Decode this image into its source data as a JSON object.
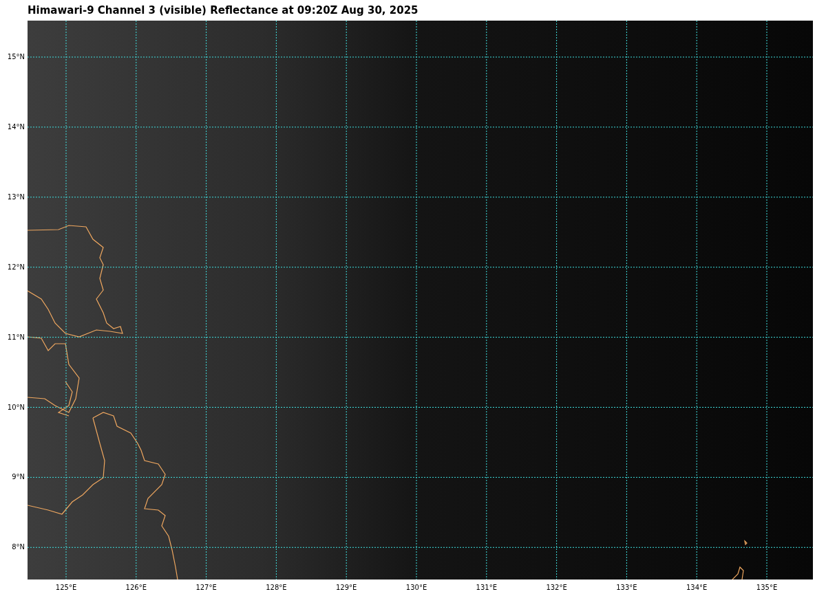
{
  "title": "Himawari-9 Channel 3 (visible) Reflectance at 09:20Z Aug 30, 2025",
  "map": {
    "latitude_labels": [
      "15°N",
      "14°N",
      "13°N",
      "12°N",
      "11°N",
      "10°N",
      "9°N",
      "8°N"
    ],
    "longitude_labels": [
      "125°E",
      "126°E",
      "127°E",
      "128°E",
      "129°E",
      "130°E",
      "131°E",
      "132°E",
      "133°E",
      "134°E",
      "135°E"
    ]
  }
}
